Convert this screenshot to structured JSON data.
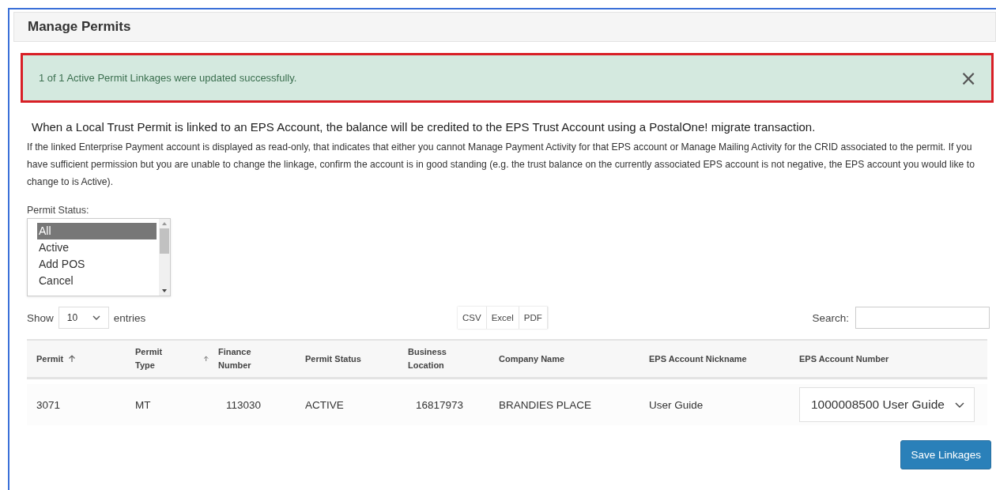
{
  "panel": {
    "title": "Manage Permits"
  },
  "alert": {
    "message": "1 of 1 Active Permit Linkages were updated successfully.",
    "close": "×"
  },
  "intro": "When a Local Trust Permit is linked to an EPS Account, the balance will be credited to the EPS Trust Account using a PostalOne! migrate transaction.",
  "note": "If the linked Enterprise Payment account is displayed as read-only, that indicates that either you cannot Manage Payment Activity for that EPS account or Manage Mailing Activity for the CRID associated to the permit. If you have sufficient permission but you are unable to change the linkage, confirm the account is in good standing (e.g. the trust balance on the currently associated EPS account is not negative, the EPS account you would like to change to is Active).",
  "permit_status": {
    "label": "Permit Status:",
    "options": [
      {
        "label": "All",
        "selected": true
      },
      {
        "label": "Active",
        "selected": false
      },
      {
        "label": "Add POS",
        "selected": false
      },
      {
        "label": "Cancel",
        "selected": false
      }
    ]
  },
  "length": {
    "before": "Show",
    "value": "10",
    "after": "entries"
  },
  "export_buttons": [
    "CSV",
    "Excel",
    "PDF"
  ],
  "search": {
    "label": "Search:"
  },
  "table": {
    "columns": [
      {
        "label": "Permit",
        "sorted": true
      },
      {
        "label": "Permit Type",
        "sorted": true
      },
      {
        "label": "Finance Number",
        "sorted": false
      },
      {
        "label": "Permit Status",
        "sorted": false
      },
      {
        "label": "Business Location",
        "sorted": false
      },
      {
        "label": "Company Name",
        "sorted": false
      },
      {
        "label": "EPS Account Nickname",
        "sorted": false
      },
      {
        "label": "EPS Account Number",
        "sorted": false
      }
    ],
    "rows": [
      {
        "cells": [
          "3071",
          "MT",
          "113030",
          "ACTIVE",
          "16817973",
          "BRANDIES PLACE",
          "User Guide"
        ],
        "account": "1000008500 User Guide"
      }
    ]
  },
  "save_button": "Save Linkages"
}
